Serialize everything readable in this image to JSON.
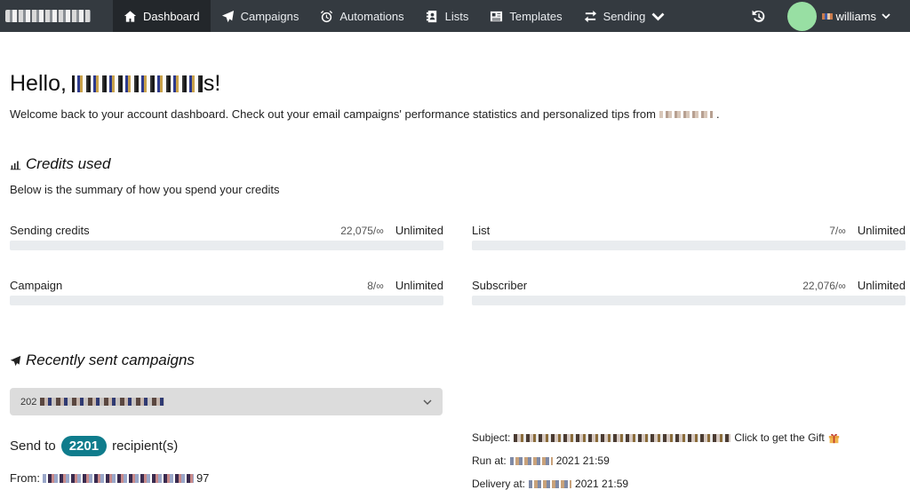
{
  "nav": {
    "items": [
      {
        "label": "Dashboard",
        "icon": "home-icon",
        "active": true
      },
      {
        "label": "Campaigns",
        "icon": "paper-plane-icon"
      },
      {
        "label": "Automations",
        "icon": "alarm-clock-icon"
      },
      {
        "label": "Lists",
        "icon": "address-book-icon"
      },
      {
        "label": "Templates",
        "icon": "newspaper-icon"
      },
      {
        "label": "Sending",
        "icon": "exchange-arrows-icon"
      }
    ],
    "user_name": "williams",
    "avatar_color": "#98dfa3",
    "bar_color": "#343a40"
  },
  "greeting": {
    "hello": "Hello,",
    "hello_suffix": "s!",
    "welcome": "Welcome back to your account dashboard. Check out your email campaigns' performance statistics and personalized tips from",
    "welcome_end": "."
  },
  "credits": {
    "title": "Credits used",
    "subtitle": "Below is the summary of how you spend your credits",
    "metrics": [
      {
        "label": "Sending credits",
        "used": "22,075/∞",
        "limit": "Unlimited"
      },
      {
        "label": "List",
        "used": "7/∞",
        "limit": "Unlimited"
      },
      {
        "label": "Campaign",
        "used": "8/∞",
        "limit": "Unlimited"
      },
      {
        "label": "Subscriber",
        "used": "22,076/∞",
        "limit": "Unlimited"
      }
    ]
  },
  "recent": {
    "title": "Recently sent campaigns",
    "select_prefix": "202",
    "send_to_prefix": "Send to",
    "recipients": "2201",
    "send_to_suffix": "recipient(s)",
    "from_label": "From:",
    "from_suffix": "97",
    "subject_label": "Subject:",
    "subject_tail": "Click to get the Gift",
    "run_at_label": "Run at:",
    "run_at_time": "2021 21:59",
    "delivery_label": "Delivery at:",
    "delivery_time": "2021 21:59",
    "accent_color": "#0f7c8c"
  }
}
